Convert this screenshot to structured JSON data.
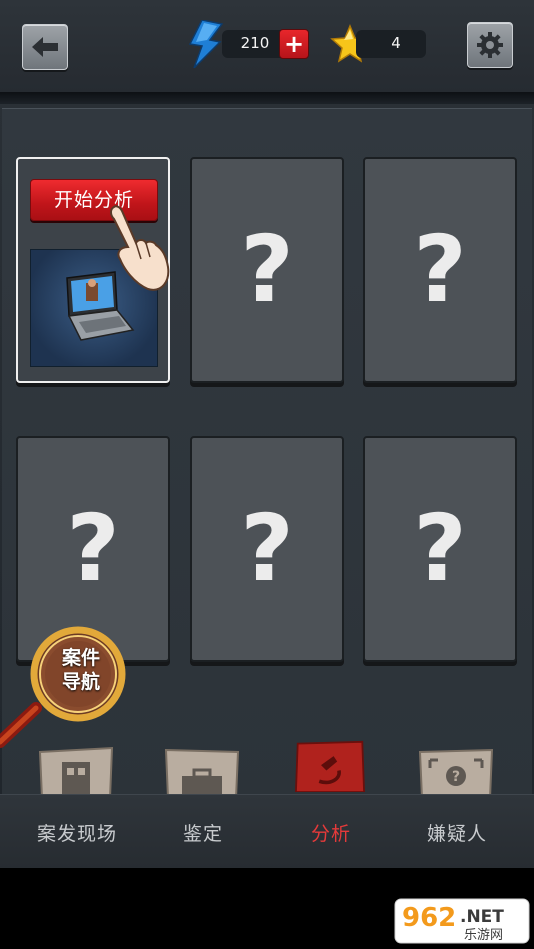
{
  "header": {
    "energy_value": "210",
    "star_value": "4",
    "icons": [
      "back-arrow-icon",
      "lightning-icon",
      "plus-icon",
      "star-icon",
      "gear-icon"
    ]
  },
  "analysis_slots": [
    {
      "state": "active",
      "button_label": "开始分析",
      "image": "laptop"
    },
    {
      "state": "locked",
      "mark": "?"
    },
    {
      "state": "locked",
      "mark": "?"
    },
    {
      "state": "locked",
      "mark": "?"
    },
    {
      "state": "locked",
      "mark": "?"
    },
    {
      "state": "locked",
      "mark": "?"
    }
  ],
  "case_navigator": {
    "line1": "案件",
    "line2": "导航"
  },
  "tabs": [
    {
      "label": "案发现场",
      "active": false,
      "icon": "building-icon"
    },
    {
      "label": "鉴定",
      "active": false,
      "icon": "briefcase-icon"
    },
    {
      "label": "分析",
      "active": true,
      "icon": "microscope-icon"
    },
    {
      "label": "嫌疑人",
      "active": false,
      "icon": "suspect-profile-icon"
    }
  ],
  "watermark": {
    "number": "962",
    "suffix": ".NET",
    "subtitle": "乐游网"
  },
  "colors": {
    "active_tab": "#e53a3a",
    "start_button": "#d81e23",
    "energy": "#2a8fe0",
    "star": "#f7c51a"
  }
}
